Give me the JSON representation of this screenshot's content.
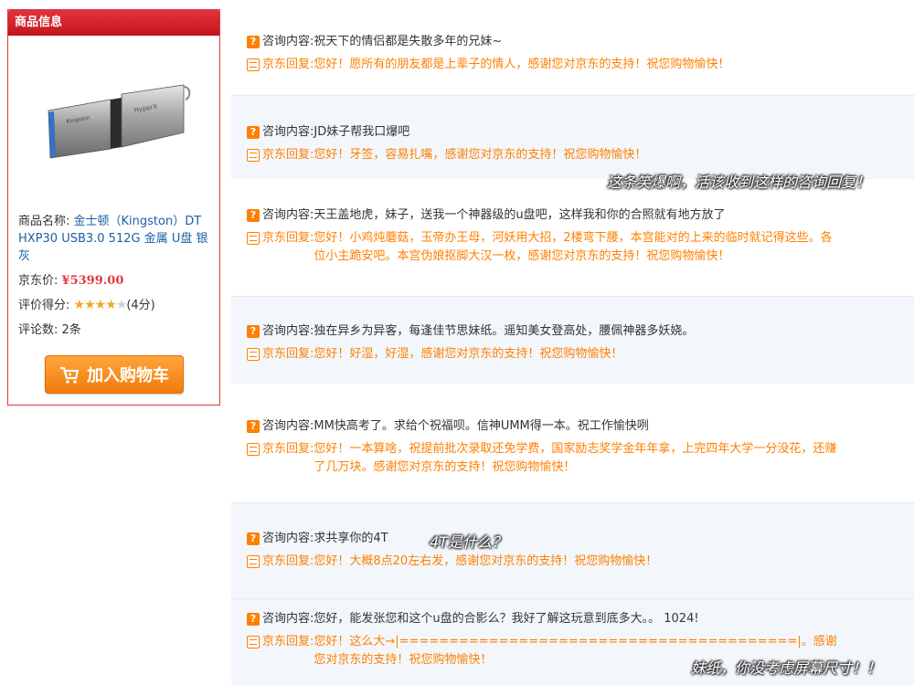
{
  "panel": {
    "title": "商品信息",
    "name_label": "商品名称:",
    "name_value": "金士顿（Kingston）DT HXP30 USB3.0 512G 金属 U盘 银灰",
    "price_label": "京东价:",
    "price_value": "¥5399.00",
    "rating_label": "评价得分:",
    "rating_stars": 4,
    "rating_text": "(4分)",
    "review_label": "评论数:",
    "review_value": "2条",
    "cart_button": "加入购物车"
  },
  "labels": {
    "question": "咨询内容:",
    "reply": "京东回复:"
  },
  "consultations": [
    {
      "question": "祝天下的情侣都是失散多年的兄妹~",
      "reply": "您好！愿所有的朋友都是上辈子的情人，感谢您对京东的支持！祝您购物愉快！"
    },
    {
      "question": "JD妹子帮我口爆吧",
      "reply": "您好！牙签，容易扎嘴，感谢您对京东的支持！祝您购物愉快！"
    },
    {
      "question": "天王盖地虎，妹子，送我一个神器级的u盘吧，这样我和你的合照就有地方放了",
      "reply": "您好！小鸡炖蘑菇，玉帝办王母，河妖用大招，2楼弯下腰，本宫能对的上来的临时就记得这些。各位小主跪安吧。本宫伪娘抠脚大汉一枚，感谢您对京东的支持！祝您购物愉快！"
    },
    {
      "question": "独在异乡为异客，每逢佳节思妹纸。遥知美女登高处，腰佩神器多妖娆。",
      "reply": "您好！好湿，好湿，感谢您对京东的支持！祝您购物愉快！"
    },
    {
      "question": "MM快高考了。求给个祝福呗。信神UMM得一本。祝工作愉快咧",
      "reply": "您好！一本算啥，祝提前批次录取还免学费，国家励志奖学金年年拿，上完四年大学一分没花，还赚了几万块。感谢您对京东的支持！祝您购物愉快！"
    },
    {
      "question": "求共享你的4T",
      "reply": "您好！大概8点20左右发，感谢您对京东的支持！祝您购物愉快！"
    },
    {
      "question": "您好，能发张您和这个u盘的合影么？我好了解这玩意到底多大。。 1024!",
      "reply": "您好！这么大→|========================================|。感谢您对京东的支持！祝您购物愉快！"
    }
  ],
  "overlays": {
    "note1": "这条笑爆啊，活该收到这样的咨询回复！",
    "note2": "4T是什么？",
    "note3": "妹纸，你没考虑屏幕尺寸！！"
  },
  "colors": {
    "accent_red": "#e4393c",
    "reply_orange": "#ff7f00",
    "link_blue": "#1b5fa8"
  }
}
